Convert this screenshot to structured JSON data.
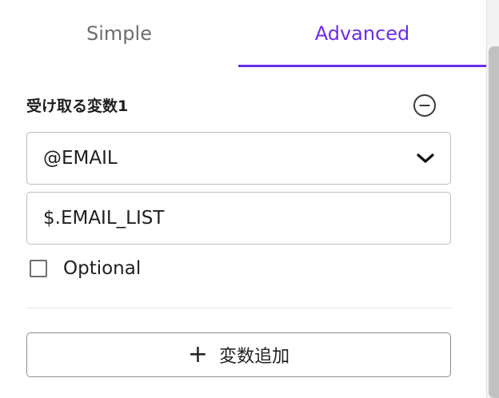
{
  "tabs": [
    {
      "label": "Simple",
      "active": false
    },
    {
      "label": "Advanced",
      "active": true
    }
  ],
  "accent_color": "#6a2ee8",
  "variable": {
    "heading": "受け取る変数1",
    "remove_icon": "minus-circle-icon",
    "select_value": "@EMAIL",
    "select_icon": "chevron-down-icon",
    "path_value": "$.EMAIL_LIST",
    "optional_label": "Optional",
    "optional_checked": false
  },
  "add_button": {
    "icon": "plus-icon",
    "label": "変数追加"
  }
}
